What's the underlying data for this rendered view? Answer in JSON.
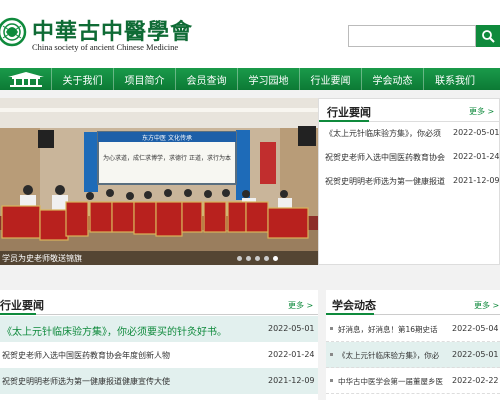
{
  "header": {
    "title": "中華古中醫學會",
    "subtitle": "China society of ancient Chinese Medicine",
    "search_placeholder": ""
  },
  "nav": {
    "items": [
      {
        "label": "关于我们"
      },
      {
        "label": "项目简介"
      },
      {
        "label": "会员查询"
      },
      {
        "label": "学习园地"
      },
      {
        "label": "行业要闻"
      },
      {
        "label": "学会动态"
      },
      {
        "label": "联系我们"
      }
    ]
  },
  "banner": {
    "caption": "学员为史老师敬送锦旗",
    "screen_title": "东方中医 文化传承",
    "screen_text": "为心求道，成仁求博学，求德行 正道，求行为本"
  },
  "top_news": {
    "title": "行业要闻",
    "more": "更多 >",
    "items": [
      {
        "title": "《太上元针临床验方集》，你必须",
        "date": "2022-05-01"
      },
      {
        "title": "祝贺史老师入选中国医药教育协会",
        "date": "2022-01-24"
      },
      {
        "title": "祝贺史明明老师选为第一健康报道",
        "date": "2021-12-09"
      }
    ]
  },
  "industry_news": {
    "title": "行业要闻",
    "more": "更多 >",
    "items": [
      {
        "title": "《太上元针临床验方集》，你必须要买的针灸好书。",
        "date": "2022-05-01"
      },
      {
        "title": "祝贺史老师入选中国医药教育协会年度创新人物",
        "date": "2022-01-24"
      },
      {
        "title": "祝贺史明明老师选为第一健康报道健康宣传大使",
        "date": "2021-12-09"
      }
    ]
  },
  "society_news": {
    "title": "学会动态",
    "more": "更多 >",
    "items": [
      {
        "title": "好消息，好消息！第16期史话",
        "date": "2022-05-04"
      },
      {
        "title": "《太上元针临床验方集》，你必",
        "date": "2022-05-01"
      },
      {
        "title": "中华古中医学会第一届董屋乡医",
        "date": "2022-02-22"
      }
    ]
  },
  "colors": {
    "brand_green": "#0f8a3c",
    "highlight_row": "#e2f0ee"
  }
}
